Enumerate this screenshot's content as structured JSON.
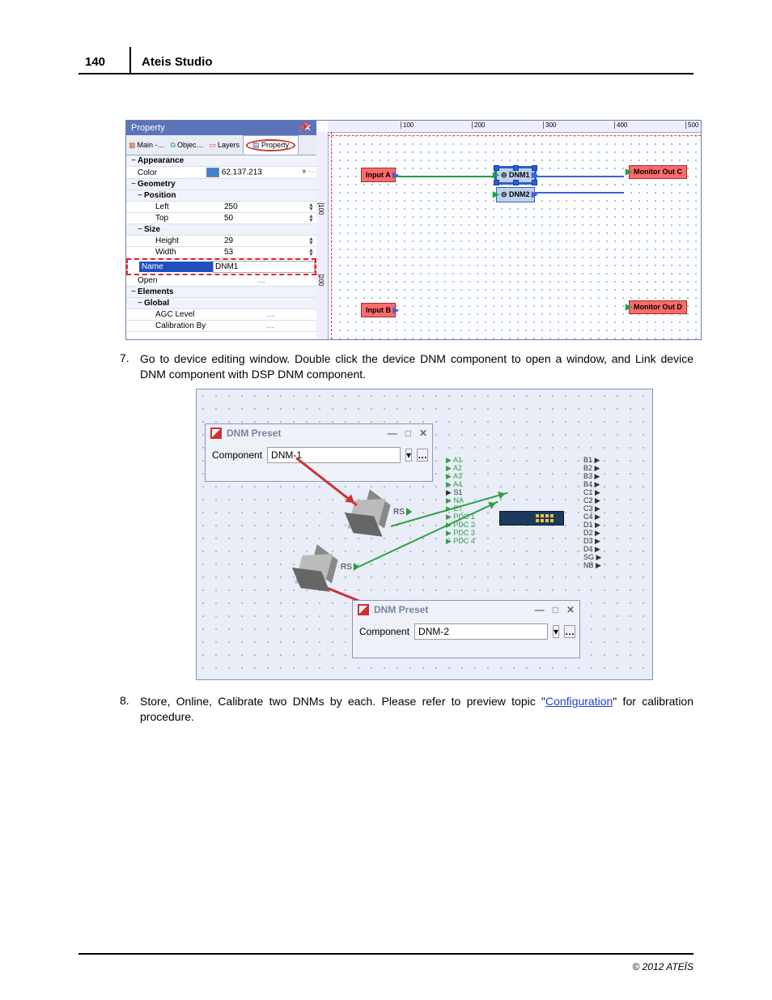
{
  "page_number": "140",
  "doc_title": "Ateis Studio",
  "copyright": "© 2012 ATEÏS",
  "shot1": {
    "panel_title": "Property",
    "tabs": {
      "main": "Main -…",
      "objects": "Objec…",
      "layers": "Layers",
      "property": "Property"
    },
    "appearance": "Appearance",
    "color_lbl": "Color",
    "color_val": "62.137.213",
    "geometry": "Geometry",
    "position": "Position",
    "left_lbl": "Left",
    "left_val": "250",
    "top_lbl": "Top",
    "top_val": "50",
    "size": "Size",
    "height_lbl": "Height",
    "height_val": "29",
    "width_lbl": "Width",
    "width_val": "53",
    "name_lbl": "Name",
    "name_val": "DNM1",
    "open_lbl": "Open",
    "open_val": "…",
    "elements": "Elements",
    "global": "Global",
    "agc_lbl": "AGC Level",
    "agc_val": "…",
    "cal_lbl": "Calibration By",
    "cal_val": "…",
    "ruler_h": [
      "100",
      "200",
      "300",
      "400",
      "500"
    ],
    "ruler_v": [
      "100",
      "200"
    ],
    "nodes": {
      "inputA": "Input A",
      "inputB": "Input B",
      "dnm1": "DNM1",
      "dnm2": "DNM2",
      "monC": "Monitor Out C",
      "monD": "Monitor Out D"
    }
  },
  "step7": {
    "num": "7.",
    "text": "Go to device editing window. Double click the device DNM component to open a window, and Link device DNM component with DSP DNM component."
  },
  "shot2": {
    "dlg_title": "DNM Preset",
    "comp_lbl": "Component",
    "comp1_val": "DNM-1",
    "comp2_val": "DNM-2",
    "rs": "RS",
    "ports_left": [
      "A1",
      "A2",
      "A3",
      "A4",
      "S1",
      "NA",
      "ET",
      "PDC 1",
      "PDC 2",
      "PDC 3",
      "PDC 4"
    ],
    "ports_right": [
      "B1",
      "B2",
      "B3",
      "B4",
      "C1",
      "C2",
      "C3",
      "C4",
      "D1",
      "D2",
      "D3",
      "D4",
      "SG",
      "NB"
    ],
    "more": "…",
    "min": "—",
    "max": "□",
    "close": "✕"
  },
  "step8": {
    "num": "8.",
    "text_a": "Store, Online, Calibrate two DNMs by each. Please refer to preview topic \"",
    "link": "Configuration",
    "text_b": "\" for calibration procedure."
  }
}
